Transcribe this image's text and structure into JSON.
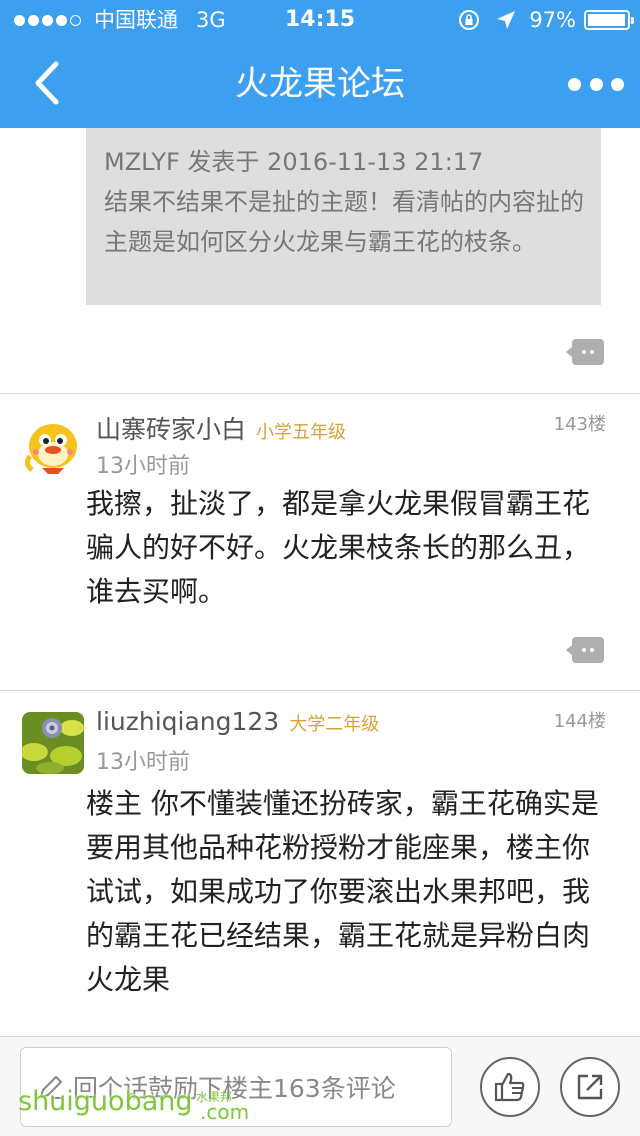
{
  "status_bar": {
    "carrier": "中国联通",
    "network": "3G",
    "time": "14:15",
    "battery": "97%",
    "battery_level": 0.97
  },
  "nav": {
    "title": "火龙果论坛"
  },
  "quote": {
    "header": "MZLYF 发表于 2016-11-13 21:17",
    "text": "结果不结果不是扯的主题！看清帖的内容扯的主题是如何区分火龙果与霸王花的枝条。"
  },
  "posts": [
    {
      "username": "山寨砖家小白",
      "level": "小学五年级",
      "floor": "143楼",
      "time": "13小时前",
      "content": "我擦，扯淡了，都是拿火龙果假冒霸王花骗人的好不好。火龙果枝条长的那么丑，谁去买啊。"
    },
    {
      "username": "liuzhiqiang123",
      "level": "大学二年级",
      "floor": "144楼",
      "time": "13小时前",
      "content": "楼主 你不懂装懂还扮砖家，霸王花确实是要用其他品种花粉授粉才能座果，楼主你试试，如果成功了你要滚出水果邦吧，我的霸王花已经结果，霸王花就是异粉白肉火龙果"
    }
  ],
  "bottom_bar": {
    "reply_placeholder": "回个话鼓励下楼主163条评论"
  },
  "watermark": {
    "text": "shuiguobang",
    "small": "水果邦",
    "suffix": ".com"
  },
  "colors": {
    "header": "#3d9ff0",
    "level": "#d8a23a",
    "watermark": "#7ec63a"
  }
}
